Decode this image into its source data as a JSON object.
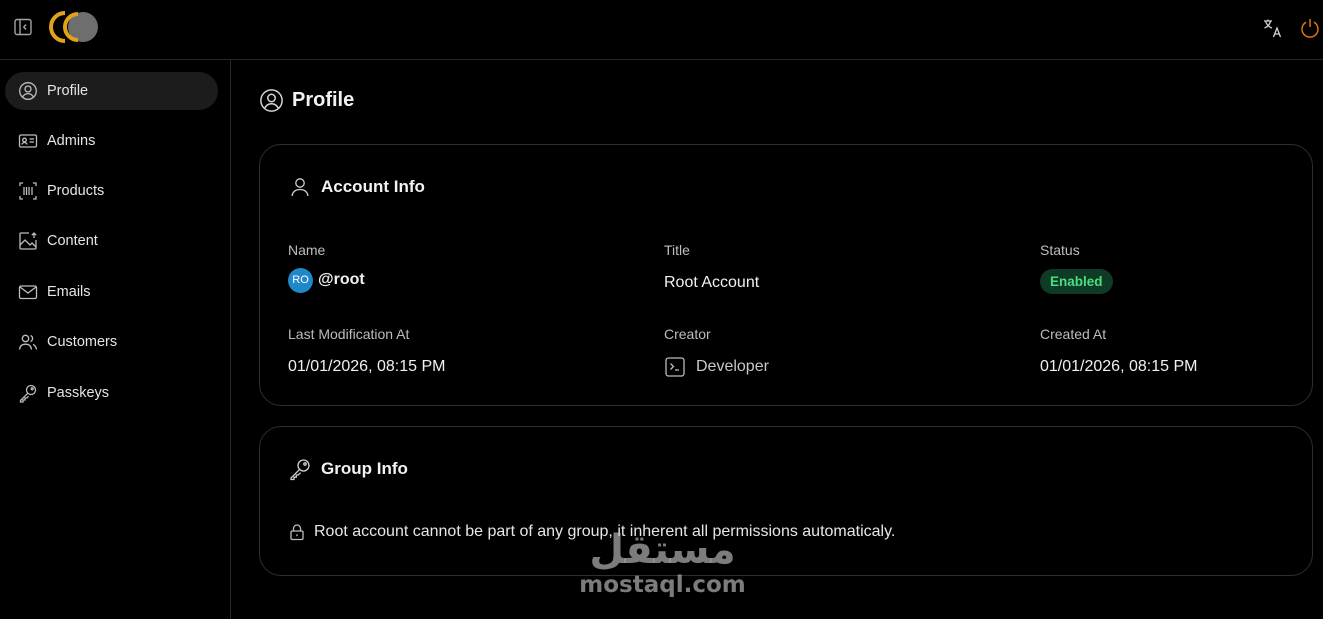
{
  "header": {
    "logo_alt": "CC"
  },
  "sidebar": {
    "items": [
      {
        "label": "Profile",
        "icon": "user-circle-icon",
        "active": true
      },
      {
        "label": "Admins",
        "icon": "id-card-icon"
      },
      {
        "label": "Products",
        "icon": "barcode-icon"
      },
      {
        "label": "Content",
        "icon": "image-upload-icon"
      },
      {
        "label": "Emails",
        "icon": "mail-icon"
      },
      {
        "label": "Customers",
        "icon": "users-icon"
      },
      {
        "label": "Passkeys",
        "icon": "key-icon"
      }
    ]
  },
  "page": {
    "title": "Profile"
  },
  "account_info": {
    "heading": "Account Info",
    "name_label": "Name",
    "avatar_initials": "RO",
    "username": "@root",
    "title_label": "Title",
    "title_value": "Root Account",
    "status_label": "Status",
    "status_value": "Enabled",
    "modified_label": "Last Modification At",
    "modified_value": "01/01/2026, 08:15 PM",
    "creator_label": "Creator",
    "creator_value": "Developer",
    "created_label": "Created At",
    "created_value": "01/01/2026, 08:15 PM"
  },
  "group_info": {
    "heading": "Group Info",
    "note": "Root account cannot be part of any group, it inherent all permissions automaticaly."
  },
  "watermark": {
    "arabic": "مستقل",
    "latin": "mostaql.com"
  },
  "colors": {
    "background": "#000000",
    "accent": "#e0a21b",
    "status_enabled": "#4ade80",
    "avatar": "#1e88c8",
    "power": "#d97706"
  }
}
